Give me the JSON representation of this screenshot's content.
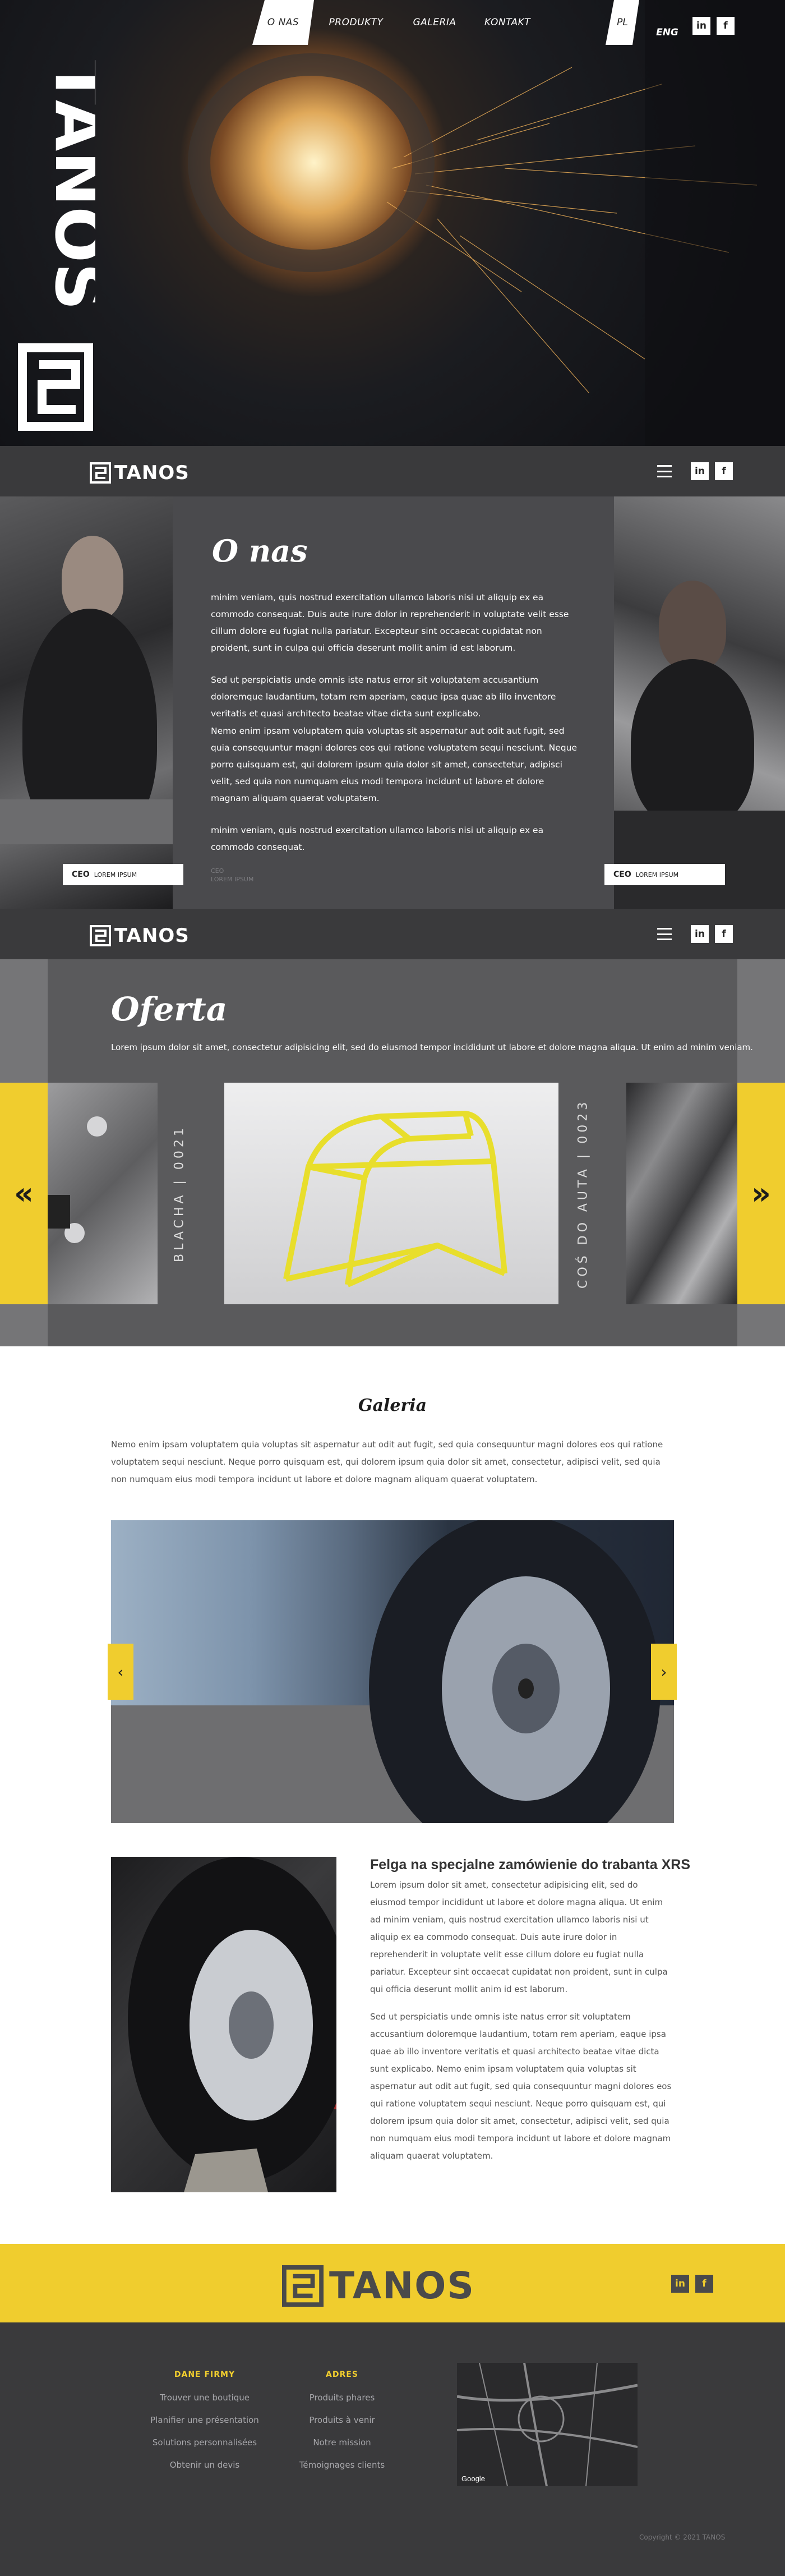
{
  "nav": {
    "items": [
      "O NAS",
      "PRODUKTY",
      "GALERIA",
      "KONTAKT"
    ],
    "active_index": 0,
    "lang": [
      "PL",
      "ENG"
    ],
    "social": [
      "in",
      "f"
    ]
  },
  "brand": {
    "name": "TANOS"
  },
  "colors": {
    "accent": "#f0cd2e",
    "dark": "#3a3a3c",
    "panel": "#4a4a4d"
  },
  "about": {
    "title": "O nas",
    "p1": "minim veniam, quis nostrud exercitation ullamco laboris nisi ut aliquip ex ea commodo consequat. Duis aute irure dolor in reprehenderit in voluptate velit esse cillum dolore eu fugiat nulla pariatur. Excepteur sint occaecat cupidatat non proident, sunt in culpa qui officia deserunt mollit anim id est laborum.",
    "p2": "Sed ut perspiciatis unde omnis iste natus error sit voluptatem accusantium doloremque laudantium, totam rem aperiam, eaque ipsa quae ab illo inventore veritatis et quasi architecto beatae vitae dicta sunt explicabo.",
    "p3": "Nemo enim ipsam voluptatem quia voluptas sit aspernatur aut odit aut fugit, sed quia consequuntur magni dolores eos qui ratione voluptatem sequi nesciunt. Neque porro quisquam est, qui dolorem ipsum quia dolor sit amet, consectetur, adipisci velit, sed quia non numquam eius modi tempora incidunt ut labore et dolore magnam aliquam quaerat voluptatem.",
    "p4": "minim veniam, quis nostrud exercitation ullamco laboris nisi ut aliquip ex ea commodo consequat.",
    "ceo_label": "CEO",
    "ceo_name": "LOREM IPSUM",
    "muted_1": "CEO",
    "muted_2": "LOREM IPSUM"
  },
  "offer": {
    "title": "Oferta",
    "subtitle": "Lorem ipsum dolor sit amet, consectetur adipisicing elit, sed do eiusmod tempor incididunt ut labore et dolore magna aliqua. Ut enim ad minim veniam.",
    "prev_icon": "double-chevron-left-icon",
    "next_icon": "double-chevron-right-icon",
    "items": [
      "BLACHA | 0021",
      "COŚ DO AUTA | 0023"
    ]
  },
  "gallery": {
    "title": "Galeria",
    "desc": "Nemo enim ipsam voluptatem quia voluptas sit aspernatur aut odit aut fugit, sed quia consequuntur magni dolores eos qui ratione voluptatem sequi nesciunt. Neque porro quisquam est, qui dolorem ipsum quia dolor sit amet, consectetur, adipisci velit, sed quia non numquam eius modi tempora incidunt ut labore et dolore magnam aliquam quaerat voluptatem."
  },
  "article": {
    "title": "Felga na specjalne zamówienie do trabanta XRS",
    "p1": "Lorem ipsum dolor sit amet, consectetur adipisicing elit, sed do eiusmod tempor incididunt ut labore et dolore magna aliqua. Ut enim ad minim veniam, quis nostrud exercitation ullamco laboris nisi ut aliquip ex ea commodo consequat. Duis aute irure dolor in reprehenderit in voluptate velit esse cillum dolore eu fugiat nulla pariatur. Excepteur sint occaecat cupidatat non proident, sunt in culpa qui officia deserunt mollit anim id est laborum.",
    "p2": "Sed ut perspiciatis unde omnis iste natus error sit voluptatem accusantium doloremque laudantium, totam rem aperiam, eaque ipsa quae ab illo inventore veritatis et quasi architecto beatae vitae dicta sunt explicabo. Nemo enim ipsam voluptatem quia voluptas sit aspernatur aut odit aut fugit, sed quia consequuntur magni dolores eos qui ratione voluptatem sequi nesciunt. Neque porro quisquam est, qui dolorem ipsum quia dolor sit amet, consectetur, adipisci velit, sed quia non numquam eius modi tempora incidunt ut labore et dolore magnam aliquam quaerat voluptatem."
  },
  "footer": {
    "col1": {
      "heading": "DANE FIRMY",
      "items": [
        "Trouver une boutique",
        "Planifier une présentation",
        "Solutions personnalisées",
        "Obtenir un devis"
      ]
    },
    "col2": {
      "heading": "ADRES",
      "items": [
        "Produits phares",
        "Produits à venir",
        "Notre mission",
        "Témoignages clients"
      ]
    },
    "map_label": "Google",
    "copyright": "Copyright © 2021 TANOS"
  }
}
